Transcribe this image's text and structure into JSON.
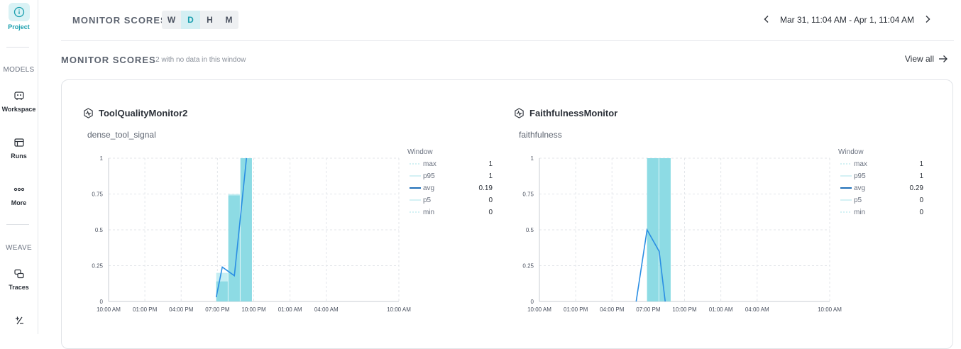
{
  "sidebar": {
    "items": [
      {
        "label": "Project",
        "icon": "info-icon"
      },
      {
        "label": "Workspace",
        "icon": "robot-icon"
      },
      {
        "label": "Runs",
        "icon": "table-icon"
      },
      {
        "label": "More",
        "icon": "more-icon"
      },
      {
        "label": "Traces",
        "icon": "layers-icon"
      },
      {
        "label": "",
        "icon": "plus-minus-icon"
      }
    ],
    "section_models": "MODELS",
    "section_weave": "WEAVE"
  },
  "topbar": {
    "title": "MONITOR SCORES",
    "periods": [
      "W",
      "D",
      "H",
      "M"
    ],
    "active_period": "D",
    "range_text": "Mar 31, 11:04 AM - Apr 1, 11:04 AM"
  },
  "section": {
    "title": "MONITOR SCORES",
    "subtitle": "· 2 with no data in this window",
    "view_all": "View all"
  },
  "colors": {
    "accent": "#1a9fae",
    "bar": "#8ddbe4",
    "bar_light": "#c5eef3",
    "avg_line": "#2a8ee3"
  },
  "chart_data": [
    {
      "type": "bar",
      "monitor": "ToolQualityMonitor2",
      "metric": "dense_tool_signal",
      "x_ticks": [
        "10:00 AM",
        "01:00 PM",
        "04:00 PM",
        "07:00 PM",
        "10:00 PM",
        "01:00 AM",
        "04:00 AM",
        "10:00 AM"
      ],
      "y_ticks": [
        "0",
        "0.25",
        "0.5",
        "0.75",
        "1"
      ],
      "ylim": [
        0,
        1
      ],
      "bins": [
        {
          "hour_offset": 8.9,
          "p95": 0.2,
          "p5": 0.14
        },
        {
          "hour_offset": 9.9,
          "p95": 0.75,
          "p5": 0.74
        },
        {
          "hour_offset": 10.9,
          "p95": 1.0,
          "p5": 1.0
        }
      ],
      "avg": [
        [
          8.9,
          0.03
        ],
        [
          9.4,
          0.24
        ],
        [
          10.4,
          0.18
        ],
        [
          11.4,
          1.0
        ]
      ],
      "legend": {
        "title": "Window",
        "rows": [
          {
            "name": "max",
            "value": "1"
          },
          {
            "name": "p95",
            "value": "1"
          },
          {
            "name": "avg",
            "value": "0.19"
          },
          {
            "name": "p5",
            "value": "0"
          },
          {
            "name": "min",
            "value": "0"
          }
        ]
      }
    },
    {
      "type": "bar",
      "monitor": "FaithfulnessMonitor",
      "metric": "faithfulness",
      "x_ticks": [
        "10:00 AM",
        "01:00 PM",
        "04:00 PM",
        "07:00 PM",
        "10:00 PM",
        "01:00 AM",
        "04:00 AM",
        "10:00 AM"
      ],
      "y_ticks": [
        "0",
        "0.25",
        "0.5",
        "0.75",
        "1"
      ],
      "ylim": [
        0,
        1
      ],
      "bins": [
        {
          "hour_offset": 8.9,
          "p95": 1.0,
          "p5": 1.0
        },
        {
          "hour_offset": 9.9,
          "p95": 1.0,
          "p5": 1.0
        }
      ],
      "avg": [
        [
          8.0,
          0.0
        ],
        [
          8.9,
          0.5
        ],
        [
          9.9,
          0.35
        ],
        [
          10.4,
          0.0
        ]
      ],
      "legend": {
        "title": "Window",
        "rows": [
          {
            "name": "max",
            "value": "1"
          },
          {
            "name": "p95",
            "value": "1"
          },
          {
            "name": "avg",
            "value": "0.29"
          },
          {
            "name": "p5",
            "value": "0"
          },
          {
            "name": "min",
            "value": "0"
          }
        ]
      }
    }
  ]
}
